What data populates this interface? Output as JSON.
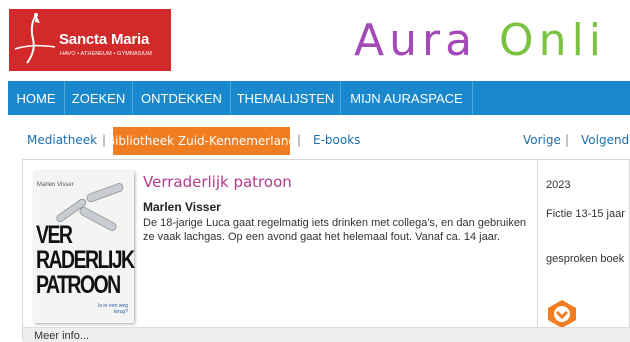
{
  "header": {
    "logo": {
      "name": "Sancta Maria",
      "subtitle": "HAVO • ATHENEUM • GYMNASIUM"
    },
    "brand": {
      "word1": "Aura",
      "word2": "Onli"
    },
    "colors": {
      "logo_bg": "#d22a2a",
      "brand_purple": "#a349b8",
      "brand_green": "#7cc242"
    }
  },
  "nav": {
    "items": [
      {
        "label": "HOME"
      },
      {
        "label": "ZOEKEN"
      },
      {
        "label": "ONTDEKKEN"
      },
      {
        "label": "THEMALIJSTEN"
      },
      {
        "label": "MIJN AURASPACE"
      }
    ],
    "color": "#1a88cc"
  },
  "tabs": {
    "mediatheek": "Mediatheek",
    "separator": "|",
    "bibliotheek": "Bibliotheek Zuid-Kennemerland",
    "ebooks": "E-books",
    "vorige": "Vorige",
    "volgende": "Volgende",
    "active_color": "#f07d22"
  },
  "result": {
    "title": "Verraderlijk patroon",
    "author": "Marlen Visser",
    "description": "De 18-jarige Luca gaat regelmatig iets drinken met collega's, en dan gebruiken ze vaak lachgas. Op een avond gaat het helemaal fout. Vanaf ca. 14 jaar.",
    "cover": {
      "author": "Marlen Visser",
      "title": "VER\nRADERLIJK\nPATROON",
      "tagline": "Is er een weg terug?"
    },
    "year": "2023",
    "genre": "Fictie 13-15 jaar",
    "format": "gesproken boek",
    "badge_icon": "aura-badge-icon",
    "more_info": "Meer info..."
  }
}
